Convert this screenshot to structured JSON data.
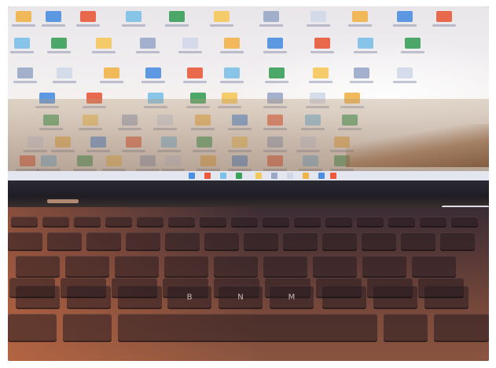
{
  "photo": {
    "subject": "laptop",
    "keyboard": {
      "key_legends": [
        "B",
        "N",
        "M"
      ]
    }
  },
  "colors": {
    "screen": "#efecee",
    "bezel": "#24222a",
    "deck": "#6a423a",
    "key_light": "#e6c6b6"
  }
}
